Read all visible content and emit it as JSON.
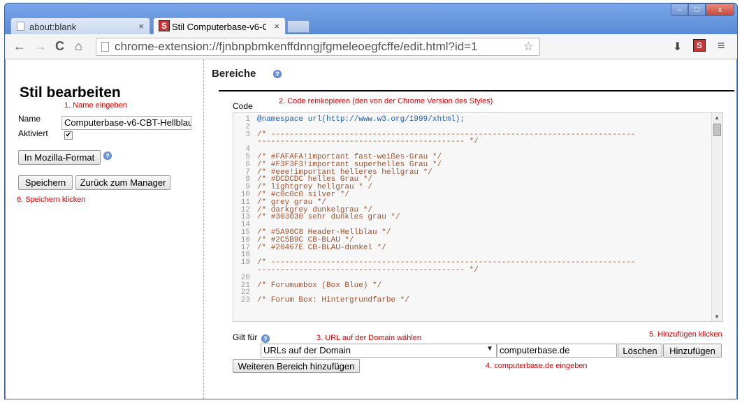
{
  "browser": {
    "tabs": [
      {
        "label": "about:blank",
        "close": "×"
      },
      {
        "label": "Stil Computerbase-v6-C",
        "close": "×",
        "icon_letter": "S"
      }
    ],
    "url": "chrome-extension://fjnbnpbmkenffdnngjfgmeleoegfcffe/edit.html?id=1",
    "nav": {
      "back": "←",
      "forward": "→",
      "reload": "C",
      "home": "⌂",
      "star": "☆",
      "download": "⬇",
      "menu": "≡",
      "ext_letter": "S"
    },
    "window_controls": {
      "minimize": "–",
      "maximize": "□",
      "close": "x"
    }
  },
  "left": {
    "title": "Stil bearbeiten",
    "note_name": "1. Name eingeben",
    "name_label": "Name",
    "name_value": "Computerbase-v6-CBT-Hellblau",
    "active_label": "Aktiviert",
    "active_checked": "✔",
    "mozilla_button": "In Mozilla-Format",
    "save_button": "Speichern",
    "back_button": "Zurück zum Manager",
    "note_save": "6. Speichern klicken"
  },
  "right": {
    "section_title": "Bereiche",
    "code_label": "Code",
    "note_code": "2. Code reinkopieren  (den von der Chrome Version des Styles)",
    "code_lines": [
      {
        "n": "1",
        "t": "@namespace url(http://www.w3.org/1999/xhtml);"
      },
      {
        "n": "2",
        "t": ""
      },
      {
        "n": "3",
        "t": "/* -------------------------------------------------------------------------------"
      },
      {
        "n": "",
        "t": "--------------------------------------------- */"
      },
      {
        "n": "4",
        "t": ""
      },
      {
        "n": "5",
        "t": "/* #FAFAFA!important fast-weißes-Grau */"
      },
      {
        "n": "6",
        "t": "/* #F3F3F3!important superhelles Grau */"
      },
      {
        "n": "7",
        "t": "/* #eee!important helleres hellgrau */"
      },
      {
        "n": "8",
        "t": "/* #DCDCDC helles Grau */"
      },
      {
        "n": "9",
        "t": "/* lightgrey hellgrau * /"
      },
      {
        "n": "10",
        "t": "/* #c0c0c0 silver */"
      },
      {
        "n": "11",
        "t": "/* grey grau */"
      },
      {
        "n": "12",
        "t": "/* darkgrey dunkelgrau */"
      },
      {
        "n": "13",
        "t": "/* #303030 sehr dunkles grau */"
      },
      {
        "n": "14",
        "t": ""
      },
      {
        "n": "15",
        "t": "/* #5A96C8 Header-Hellblau */"
      },
      {
        "n": "16",
        "t": "/* #2C5B9C CB-BLAU */"
      },
      {
        "n": "17",
        "t": "/* #20467E CB-BLAU-dunkel */"
      },
      {
        "n": "18",
        "t": ""
      },
      {
        "n": "19",
        "t": "/* -------------------------------------------------------------------------------"
      },
      {
        "n": "",
        "t": "--------------------------------------------- */"
      },
      {
        "n": "20",
        "t": ""
      },
      {
        "n": "21",
        "t": "/* Forumumbox (Box Blue) */"
      },
      {
        "n": "22",
        "t": ""
      },
      {
        "n": "23",
        "t": "/* Forum Box: Hintergrundfarbe */"
      }
    ],
    "applies_label": "Gilt für",
    "note_url": "3. URL auf der Domain wählen",
    "select_value": "URLs auf der Domain",
    "domain_value": "computerbase.de",
    "delete_button": "Löschen",
    "add_button": "Hinzufügen",
    "note_add": "5. Hinzufügen klicken",
    "more_button": "Weiteren Bereich hinzufügen",
    "note_domain": "4. computerbase.de eingeben"
  }
}
